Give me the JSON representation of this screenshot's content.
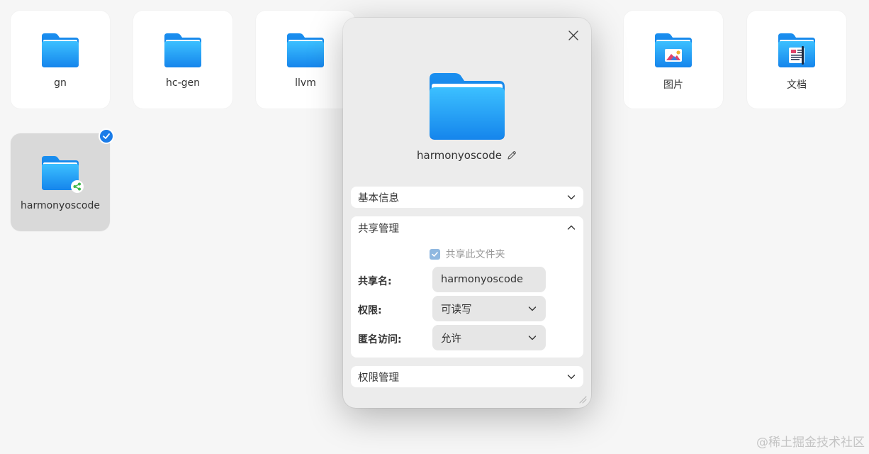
{
  "files": [
    {
      "name": "gn",
      "icon": "folder-icon"
    },
    {
      "name": "hc-gen",
      "icon": "folder-icon"
    },
    {
      "name": "llvm",
      "icon": "folder-icon"
    },
    {
      "name": "图片",
      "icon": "pictures-folder-icon"
    },
    {
      "name": "文档",
      "icon": "documents-folder-icon"
    },
    {
      "name": "harmonyoscode",
      "icon": "shared-folder-icon",
      "selected": true
    }
  ],
  "dialog": {
    "folder_name": "harmonyoscode",
    "sections": {
      "basic_info": {
        "title": "基本信息",
        "expanded": false
      },
      "share_management": {
        "title": "共享管理",
        "expanded": true,
        "share_checkbox_label": "共享此文件夹",
        "share_checked": true,
        "share_name_label": "共享名:",
        "share_name_value": "harmonyoscode",
        "permission_label": "权限:",
        "permission_value": "可读写",
        "anonymous_label": "匿名访问:",
        "anonymous_value": "允许"
      },
      "permission_management": {
        "title": "权限管理",
        "expanded": false
      }
    }
  },
  "watermark": "@稀土掘金技术社区",
  "colors": {
    "accent": "#1a7ce8",
    "folder_light": "#3ab6ff",
    "folder_dark": "#1a86ee"
  }
}
